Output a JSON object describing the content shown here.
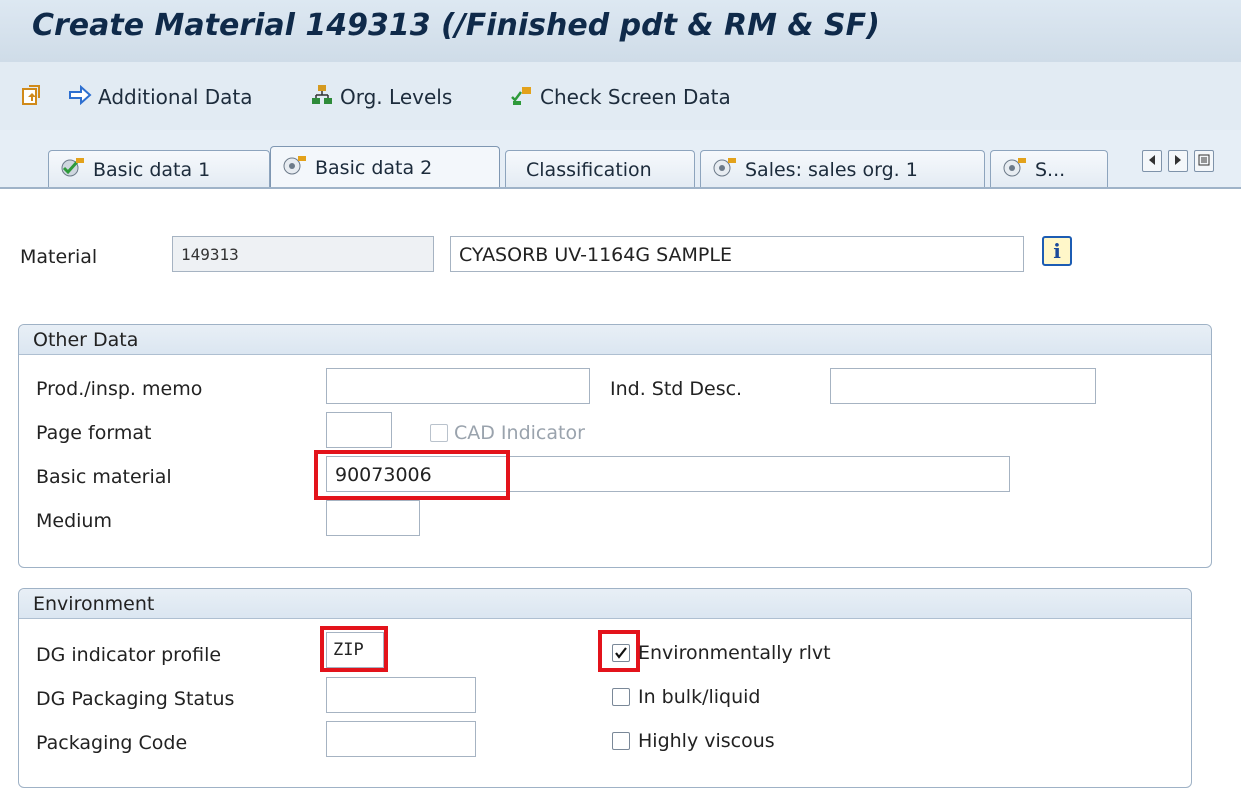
{
  "window": {
    "title": "Create Material 149313 (/Finished pdt & RM & SF)"
  },
  "toolbar": {
    "additional_data": "Additional Data",
    "org_levels": "Org. Levels",
    "check_screen_data": "Check Screen Data"
  },
  "tabs": [
    {
      "label": "Basic data 1",
      "icon": "green-check-icon"
    },
    {
      "label": "Basic data 2",
      "icon": "target-icon"
    },
    {
      "label": "Classification",
      "icon": ""
    },
    {
      "label": "Sales: sales org. 1",
      "icon": "target-icon"
    },
    {
      "label": "S...",
      "icon": "target-icon"
    }
  ],
  "active_tab": "Basic data 2",
  "material": {
    "label": "Material",
    "number": "149313",
    "description": "CYASORB UV-1164G SAMPLE"
  },
  "other_data": {
    "title": "Other Data",
    "prod_insp_memo_label": "Prod./insp. memo",
    "prod_insp_memo_value": "",
    "ind_std_desc_label": "Ind. Std Desc.",
    "ind_std_desc_value": "",
    "page_format_label": "Page format",
    "page_format_value": "",
    "cad_indicator_label": "CAD Indicator",
    "cad_indicator_checked": false,
    "basic_material_label": "Basic material",
    "basic_material_value": "90073006",
    "medium_label": "Medium",
    "medium_value": ""
  },
  "environment": {
    "title": "Environment",
    "dg_indicator_profile_label": "DG indicator profile",
    "dg_indicator_profile_value": "ZIP",
    "dg_packaging_status_label": "DG Packaging Status",
    "dg_packaging_status_value": "",
    "packaging_code_label": "Packaging Code",
    "packaging_code_value": "",
    "env_relevant_label": "Environmentally rlvt",
    "env_relevant_checked": true,
    "in_bulk_label": "In bulk/liquid",
    "in_bulk_checked": false,
    "highly_viscous_label": "Highly viscous",
    "highly_viscous_checked": false
  },
  "colors": {
    "highlight": "#e3131b",
    "title": "#0f2a4a",
    "header_bg": "#dde8f2"
  }
}
